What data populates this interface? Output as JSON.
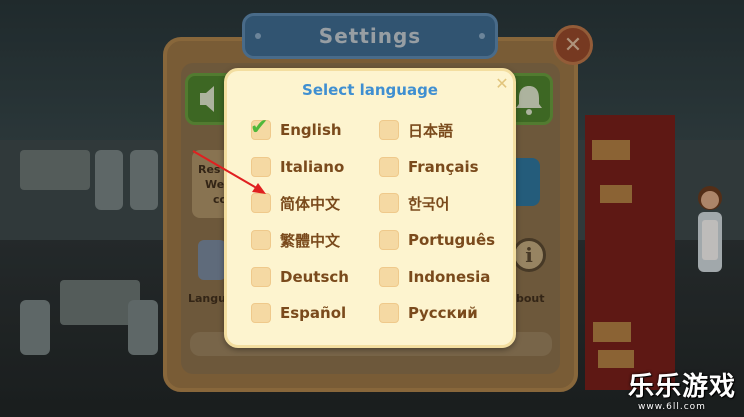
{
  "settings": {
    "title": "Settings",
    "close_glyph": "✕",
    "left_card_text": [
      "Res",
      "We",
      "co"
    ],
    "language_button_label": "Langu",
    "about_button_label": "bout",
    "info_glyph": "i"
  },
  "language_dialog": {
    "title": "Select language",
    "close_glyph": "✕",
    "selected": "English",
    "options": [
      {
        "label": "English",
        "checked": true
      },
      {
        "label": "日本語",
        "checked": false
      },
      {
        "label": "Italiano",
        "checked": false
      },
      {
        "label": "Français",
        "checked": false
      },
      {
        "label": "简体中文",
        "checked": false
      },
      {
        "label": "한국어",
        "checked": false
      },
      {
        "label": "繁體中文",
        "checked": false
      },
      {
        "label": "Português",
        "checked": false
      },
      {
        "label": "Deutsch",
        "checked": false
      },
      {
        "label": "Indonesia",
        "checked": false
      },
      {
        "label": "Español",
        "checked": false
      },
      {
        "label": "Русский",
        "checked": false
      }
    ],
    "check_glyph": "✔"
  },
  "watermark": {
    "brand": "乐乐游戏",
    "url": "www.6ll.com"
  },
  "colors": {
    "dialog_bg": "#fdf4cf",
    "title_blue": "#3f8fd1",
    "label_brown": "#7a4a1c",
    "checkbox": "#f5d9a3",
    "check_green": "#4fb83a",
    "arrow_red": "#e02020"
  }
}
